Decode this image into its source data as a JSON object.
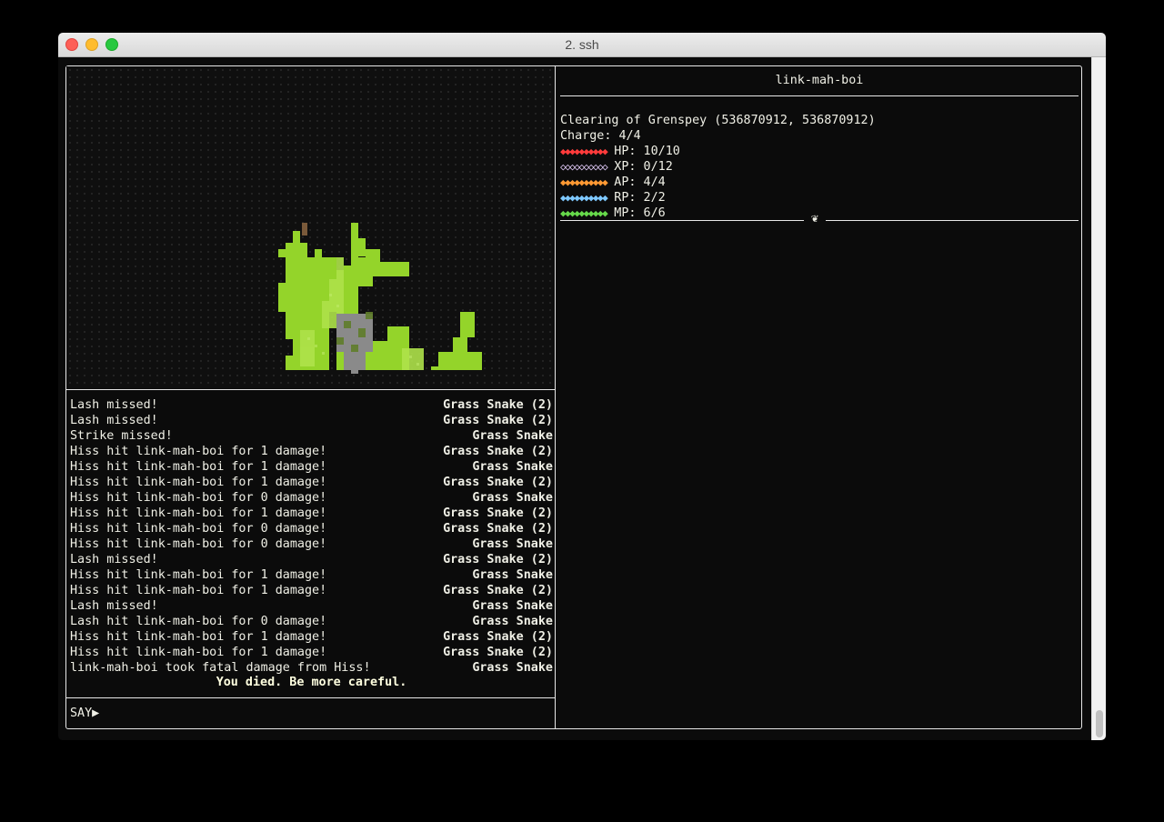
{
  "window": {
    "title": "2. ssh"
  },
  "colors": {
    "hp": "#ff3b3b",
    "xp": "#e8d0ff",
    "ap": "#ff9933",
    "rp": "#7ec8ff",
    "mp": "#66d94a",
    "snake_green": "#94d42a",
    "snake_light": "#aee24a"
  },
  "log": [
    {
      "msg": "Lash missed!",
      "src": "Grass Snake (2)"
    },
    {
      "msg": "Lash missed!",
      "src": "Grass Snake (2)"
    },
    {
      "msg": "Strike missed!",
      "src": "Grass Snake"
    },
    {
      "msg": "Hiss hit link-mah-boi for 1 damage!",
      "src": "Grass Snake (2)"
    },
    {
      "msg": "Hiss hit link-mah-boi for 1 damage!",
      "src": "Grass Snake"
    },
    {
      "msg": "Hiss hit link-mah-boi for 1 damage!",
      "src": "Grass Snake (2)"
    },
    {
      "msg": "Hiss hit link-mah-boi for 0 damage!",
      "src": "Grass Snake"
    },
    {
      "msg": "Hiss hit link-mah-boi for 1 damage!",
      "src": "Grass Snake (2)"
    },
    {
      "msg": "Hiss hit link-mah-boi for 0 damage!",
      "src": "Grass Snake (2)"
    },
    {
      "msg": "Hiss hit link-mah-boi for 0 damage!",
      "src": "Grass Snake"
    },
    {
      "msg": "Lash missed!",
      "src": "Grass Snake (2)"
    },
    {
      "msg": "Hiss hit link-mah-boi for 1 damage!",
      "src": "Grass Snake"
    },
    {
      "msg": "Hiss hit link-mah-boi for 1 damage!",
      "src": "Grass Snake (2)"
    },
    {
      "msg": "Lash missed!",
      "src": "Grass Snake"
    },
    {
      "msg": "Lash hit link-mah-boi for 0 damage!",
      "src": "Grass Snake"
    },
    {
      "msg": "Hiss hit link-mah-boi for 1 damage!",
      "src": "Grass Snake (2)"
    },
    {
      "msg": "Hiss hit link-mah-boi for 1 damage!",
      "src": "Grass Snake (2)"
    },
    {
      "msg": "link-mah-boi took fatal damage from Hiss!",
      "src": "Grass Snake"
    }
  ],
  "death_message": "You died. Be more careful.",
  "prompt": "SAY▶",
  "character": {
    "name": "link-mah-boi",
    "location": "Clearing of Grenspey (536870912, 536870912)",
    "charge": "Charge: 4/4",
    "stats": [
      {
        "key": "hp",
        "diamonds": "◆◆◆◆◆◆◆◆◆◆",
        "label": "HP: 10/10",
        "color": "#ff3b3b",
        "filled": 10,
        "max": 10
      },
      {
        "key": "xp",
        "diamonds": "◇◇◇◇◇◇◇◇◇◇",
        "label": "XP: 0/12",
        "color": "#e8d0ff",
        "filled": 0,
        "max": 12
      },
      {
        "key": "ap",
        "diamonds": "◆◆◆◆◆◆◆◆◆◆",
        "label": "AP: 4/4",
        "color": "#ff9933",
        "filled": 4,
        "max": 4
      },
      {
        "key": "rp",
        "diamonds": "◆◆◆◆◆◆◆◆◆◆",
        "label": "RP: 2/2",
        "color": "#7ec8ff",
        "filled": 2,
        "max": 2
      },
      {
        "key": "mp",
        "diamonds": "◆◆◆◆◆◆◆◆◆◆",
        "label": "MP: 6/6",
        "color": "#66d94a",
        "filled": 6,
        "max": 6
      }
    ],
    "divider_icon": "❦"
  }
}
